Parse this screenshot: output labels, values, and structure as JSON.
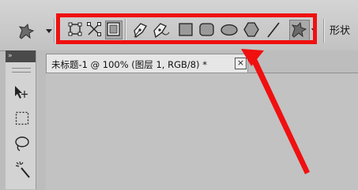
{
  "options_bar": {
    "tool_preset_icon": "custom-shape-preset-icon",
    "mode_buttons": [
      "shape-layers-icon",
      "paths-icon",
      "fill-pixels-icon"
    ],
    "shape_tools": [
      "pen-icon",
      "freeform-pen-icon",
      "rectangle-icon",
      "rounded-rectangle-icon",
      "ellipse-icon",
      "polygon-icon",
      "line-icon",
      "custom-shape-icon"
    ],
    "shape_label": "形状",
    "highlight_color": "#f01010"
  },
  "tools_panel": {
    "collapse_label": "»",
    "tools": [
      "move-icon",
      "rectangular-marquee-icon",
      "lasso-icon",
      "magic-wand-icon"
    ]
  },
  "document": {
    "tab_title": "未标题-1 @ 100% (图层 1, RGB/8) *",
    "close_label": "×"
  },
  "annotation": {
    "arrow_color": "#f01010"
  }
}
